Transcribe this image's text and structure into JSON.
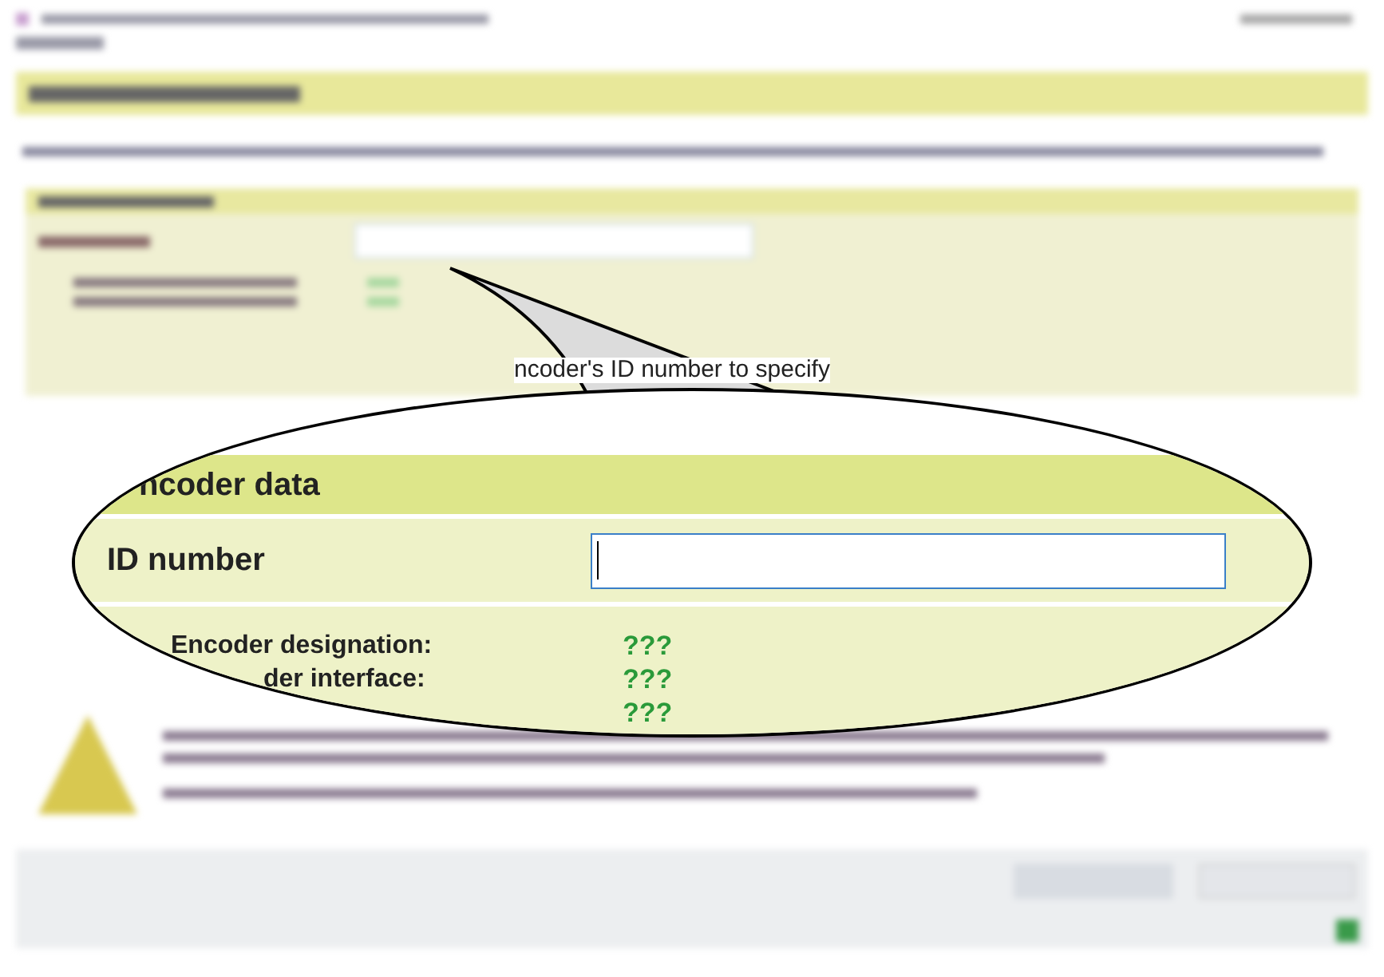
{
  "callout": {
    "caption": "ncoder's ID number to specify",
    "section_title": "ncoder data",
    "field_label": "ID number",
    "rows": [
      {
        "label": "Encoder designation:",
        "value": "???"
      },
      {
        "label": "der interface:",
        "value": "???"
      },
      {
        "value": "???"
      }
    ]
  }
}
